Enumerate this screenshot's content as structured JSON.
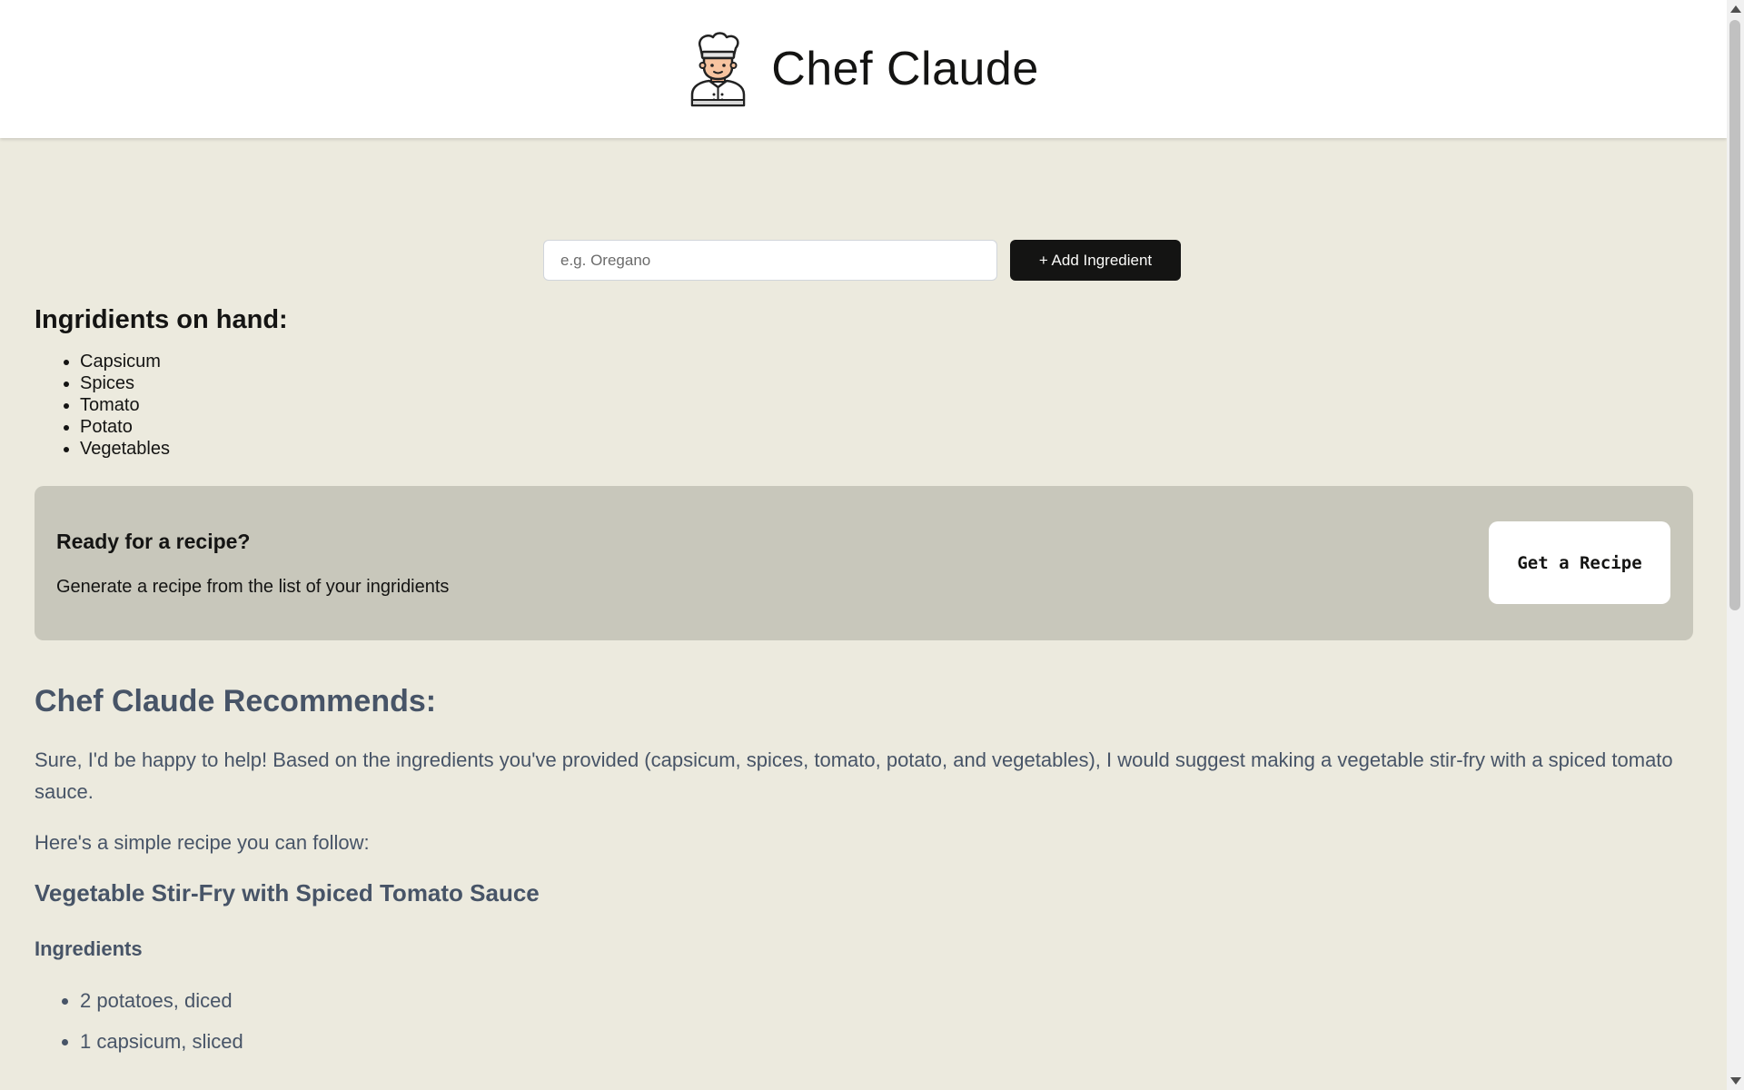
{
  "header": {
    "title": "Chef Claude",
    "logo_icon": "chef-icon"
  },
  "form": {
    "input_placeholder": "e.g. Oregano",
    "input_value": "",
    "add_button_label": "+ Add Ingredient"
  },
  "ingredients": {
    "heading": "Ingridients on hand:",
    "items": [
      "Capsicum",
      "Spices",
      "Tomato",
      "Potato",
      "Vegetables"
    ]
  },
  "cta": {
    "title": "Ready for a recipe?",
    "subtitle": "Generate a recipe from the list of your ingridients",
    "button_label": "Get a Recipe"
  },
  "recommendation": {
    "heading": "Chef Claude Recommends:",
    "paragraph1": "Sure, I'd be happy to help! Based on the ingredients you've provided (capsicum, spices, tomato, potato, and vegetables), I would suggest making a vegetable stir-fry with a spiced tomato sauce.",
    "paragraph2": "Here's a simple recipe you can follow:",
    "recipe_title": "Vegetable Stir-Fry with Spiced Tomato Sauce",
    "ingredients_heading": "Ingredients",
    "recipe_ingredients": [
      "2 potatoes, diced",
      "1 capsicum, sliced"
    ]
  },
  "colors": {
    "background": "#ECEADE",
    "header_bg": "#FFFFFF",
    "cta_bg": "#C8C7BB",
    "primary_button": "#141413",
    "recommendation_text": "#475467"
  }
}
